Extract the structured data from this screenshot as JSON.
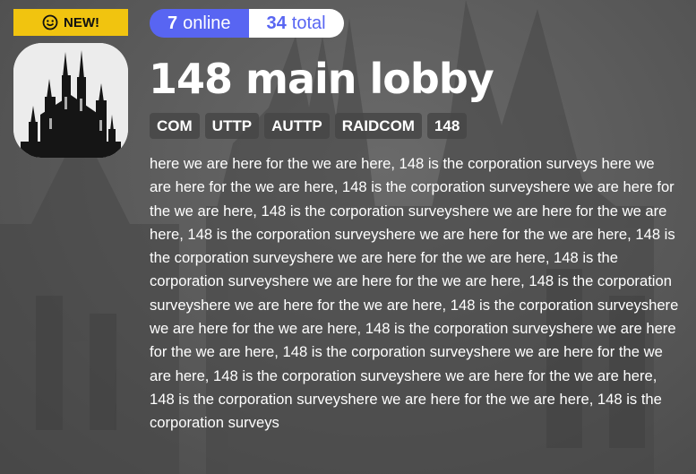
{
  "badge": {
    "label": "NEW!",
    "icon": "smile-face-icon"
  },
  "counts": {
    "online_value": "7",
    "online_label": "online",
    "total_value": "34",
    "total_label": "total",
    "online_color": "#5865f2",
    "total_color": "#ffffff"
  },
  "server": {
    "title": "148 main lobby",
    "tags": [
      "COM",
      "UTTP",
      "AUTTP",
      "RAIDCOM",
      "148"
    ],
    "description": "here we are here for the we are here, 148 is the corporation surveys here we are here for the we are here, 148 is the corporation surveyshere we are here for the we are here, 148 is the corporation surveyshere we are here for the we are here, 148 is the corporation surveyshere we are here for the we are here, 148 is the corporation surveyshere we are here for the we are here, 148 is the corporation surveyshere we are here for the we are here, 148 is the corporation surveyshere we are here for the we are here, 148 is the corporation surveyshere we are here for the we are here, 148 is the corporation surveyshere we are here for the we are here, 148 is the corporation surveyshere we are here for the we are here, 148 is the corporation surveyshere we are here for the we are here, 148 is the corporation surveyshere we are here for the we are here, 148 is the corporation surveys"
  },
  "colors": {
    "accent": "#5865f2",
    "badge": "#f1c40f"
  }
}
